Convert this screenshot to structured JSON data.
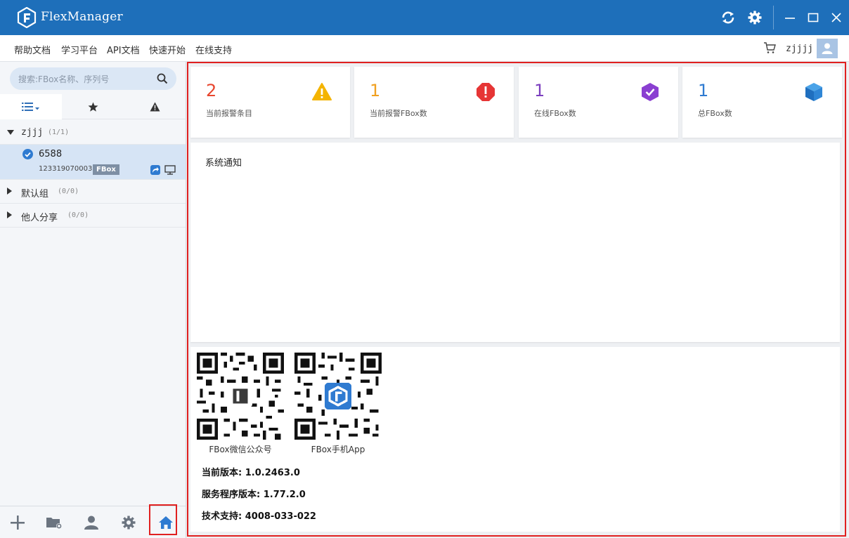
{
  "app": {
    "title": "FlexManager"
  },
  "titlebar": {
    "icons": [
      "refresh-icon",
      "gear-icon",
      "minimize-icon",
      "maximize-icon",
      "close-icon"
    ]
  },
  "menu": {
    "items": [
      "帮助文档",
      "学习平台",
      "API文档",
      "快速开始",
      "在线支持"
    ],
    "username": "zjjjj"
  },
  "sidebar": {
    "search_placeholder": "搜索:FBox名称、序列号",
    "tabs": [
      "list-icon",
      "star-icon",
      "warning-icon"
    ],
    "groups": [
      {
        "name": "zjjj",
        "count": "(1/1)",
        "expanded": true
      },
      {
        "name": "默认组",
        "count": "(0/0)",
        "expanded": false
      },
      {
        "name": "他人分享",
        "count": "(0/0)",
        "expanded": false
      }
    ],
    "device": {
      "name": "6588",
      "serial": "123319070003",
      "badge": "FBox"
    },
    "bottom": [
      "add-icon",
      "folder-settings-icon",
      "user-icon",
      "settings-icon",
      "home-icon"
    ]
  },
  "stats": [
    {
      "value": "2",
      "label": "当前报警条目",
      "color": "#e8462e",
      "icon": "warning-triangle-icon"
    },
    {
      "value": "1",
      "label": "当前报警FBox数",
      "color": "#f0a020",
      "icon": "alert-octagon-icon"
    },
    {
      "value": "1",
      "label": "在线FBox数",
      "color": "#7c3fbf",
      "icon": "check-shield-icon"
    },
    {
      "value": "1",
      "label": "总FBox数",
      "color": "#2f7bd1",
      "icon": "cube-icon"
    }
  ],
  "notice": {
    "title": "系统通知"
  },
  "qrcodes": [
    {
      "caption": "FBox微信公众号"
    },
    {
      "caption": "FBox手机App"
    }
  ],
  "versions": {
    "current": "当前版本: 1.0.2463.0",
    "service": "服务程序版本: 1.77.2.0",
    "support": "技术支持: 4008-033-022"
  }
}
